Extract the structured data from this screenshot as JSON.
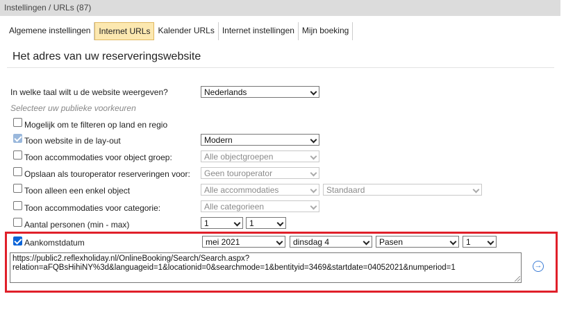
{
  "header": {
    "breadcrumb": "Instellingen / URLs (87)"
  },
  "tabs": [
    {
      "label": "Algemene instellingen"
    },
    {
      "label": "Internet URLs"
    },
    {
      "label": "Kalender URLs"
    },
    {
      "label": "Internet instellingen"
    },
    {
      "label": "Mijn boeking"
    }
  ],
  "section": {
    "title": "Het adres van uw reserveringswebsite"
  },
  "language": {
    "label": "In welke taal wilt u de website weergeven?",
    "value": "Nederlands"
  },
  "preferences_hint": "Selecteer uw publieke voorkeuren",
  "options": {
    "filter_country": {
      "label": "Mogelijk om te filteren op land en regio",
      "checked": false
    },
    "layout": {
      "label": "Toon website in de lay-out",
      "checked": true,
      "value": "Modern"
    },
    "object_group": {
      "label": "Toon accommodaties voor object groep:",
      "checked": false,
      "value": "Alle objectgroepen"
    },
    "touroperator": {
      "label": "Opslaan als touroperator reserveringen voor:",
      "checked": false,
      "value": "Geen touroperator"
    },
    "single_object": {
      "label": "Toon alleen een enkel object",
      "checked": false,
      "value": "Alle accommodaties",
      "value2": "Standaard"
    },
    "category": {
      "label": "Toon accommodaties voor categorie:",
      "checked": false,
      "value": "Alle categorieen"
    },
    "persons": {
      "label": "Aantal personen (min - max)",
      "checked": false,
      "min": "1",
      "max": "1"
    },
    "arrival": {
      "label": "Aankomstdatum",
      "checked": true,
      "month": "mei 2021",
      "day": "dinsdag 4",
      "period": "Pasen",
      "count": "1"
    }
  },
  "url": {
    "line1": "https://public2.reflexholiday.nl/OnlineBooking/Search/Search.aspx?",
    "line2": "relation=aFQBsHihiNY%3d&languageid=1&locationid=0&searchmode=1&bentityid=3469&startdate=04052021&numperiod=1"
  },
  "colors": {
    "accent": "#0a64d8",
    "highlight": "#e0202a",
    "active_tab": "#fce8b0"
  }
}
